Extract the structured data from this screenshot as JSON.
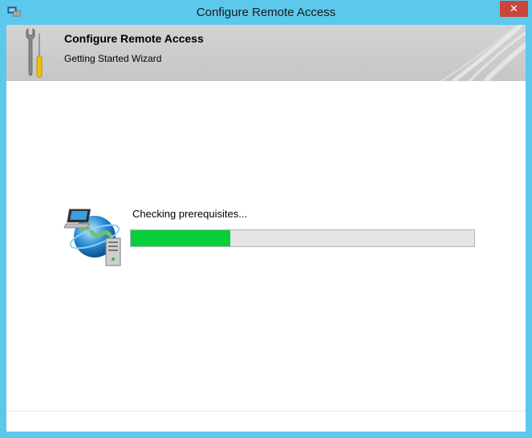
{
  "window": {
    "title": "Configure Remote Access",
    "close_label": "✕",
    "app_icon": "remote-access-console-icon"
  },
  "header": {
    "title": "Configure Remote Access",
    "subtitle": "Getting Started Wizard",
    "icon": "tools-wrench-screwdriver-icon"
  },
  "main": {
    "status_text": "Checking prerequisites...",
    "progress_fraction": 0.29,
    "illustration_icon": "network-globe-computer-icon"
  },
  "colors": {
    "titlebar": "#5bc8ec",
    "close_button": "#c7473b",
    "progress_fill": "#06cf39",
    "header_band": "#cccccc"
  }
}
